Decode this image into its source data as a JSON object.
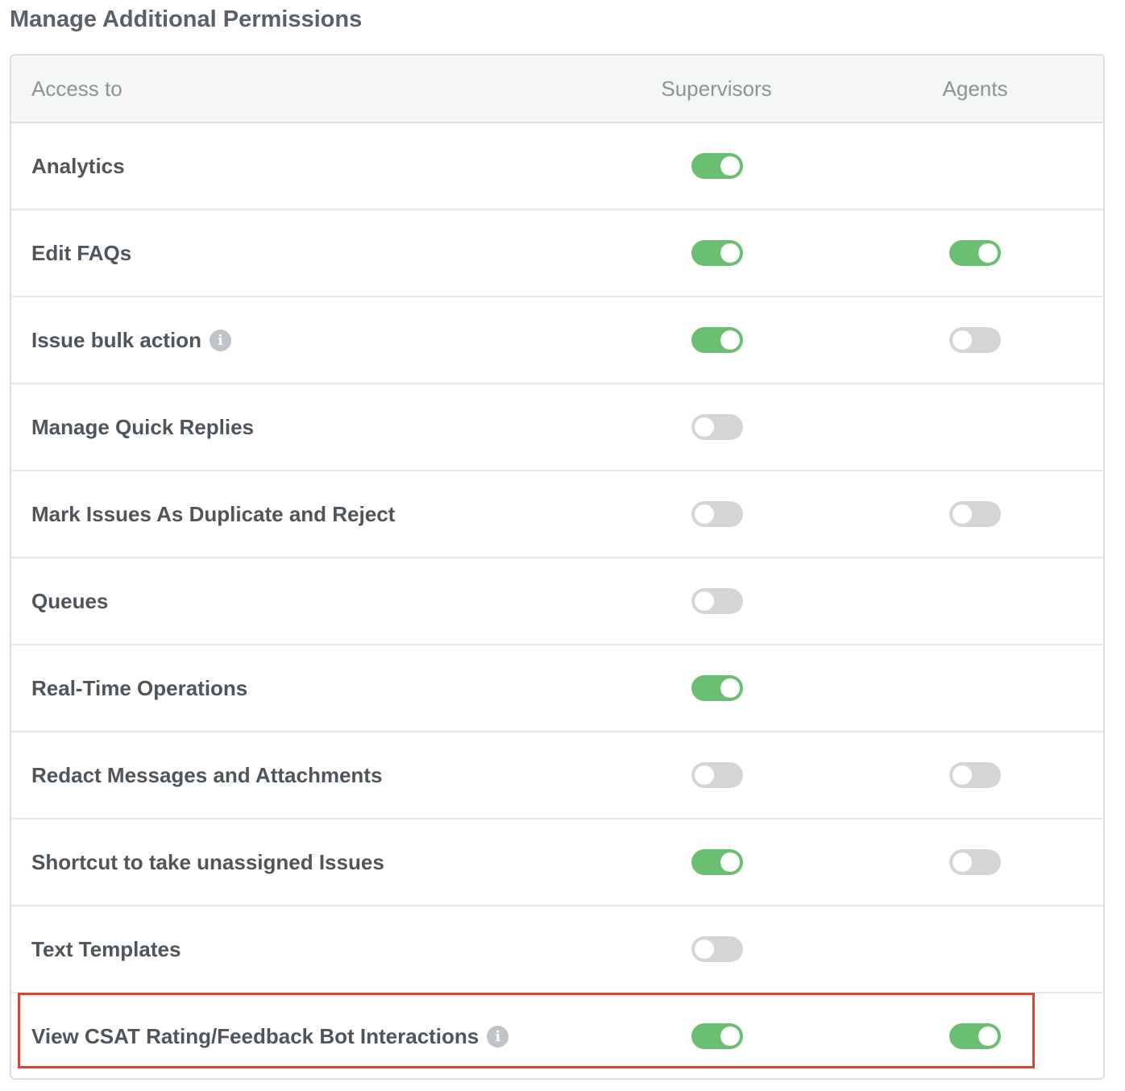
{
  "page_title": "Manage Additional Permissions",
  "table": {
    "headers": {
      "access": "Access to",
      "supervisors": "Supervisors",
      "agents": "Agents"
    },
    "rows": [
      {
        "label": "Analytics",
        "info": false,
        "supervisors": true,
        "agents": null
      },
      {
        "label": "Edit FAQs",
        "info": false,
        "supervisors": true,
        "agents": true
      },
      {
        "label": "Issue bulk action",
        "info": true,
        "supervisors": true,
        "agents": false
      },
      {
        "label": "Manage Quick Replies",
        "info": false,
        "supervisors": false,
        "agents": null
      },
      {
        "label": "Mark Issues As Duplicate and Reject",
        "info": false,
        "supervisors": false,
        "agents": false
      },
      {
        "label": "Queues",
        "info": false,
        "supervisors": false,
        "agents": null
      },
      {
        "label": "Real-Time Operations",
        "info": false,
        "supervisors": true,
        "agents": null
      },
      {
        "label": "Redact Messages and Attachments",
        "info": false,
        "supervisors": false,
        "agents": false
      },
      {
        "label": "Shortcut to take unassigned Issues",
        "info": false,
        "supervisors": true,
        "agents": false
      },
      {
        "label": "Text Templates",
        "info": false,
        "supervisors": false,
        "agents": null
      },
      {
        "label": "View CSAT Rating/Feedback Bot Interactions",
        "info": true,
        "supervisors": true,
        "agents": true
      }
    ]
  },
  "highlighted_row": "View CSAT Rating/Feedback Bot Interactions",
  "colors": {
    "toggle_on": "#6bbf73",
    "toggle_off": "#d3d5d7",
    "highlight_border": "#e0432f",
    "info_icon": "#bfc4c8"
  },
  "icons": {
    "info": "info-circle-icon"
  }
}
